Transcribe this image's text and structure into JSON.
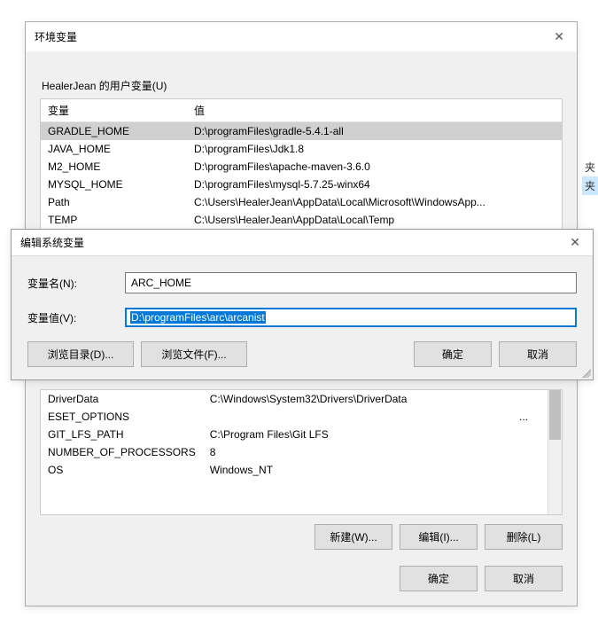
{
  "right_fragment": {
    "l1": "夹",
    "l2": "夹"
  },
  "env_dialog": {
    "title": "环境变量",
    "user_label": "HealerJean 的用户变量(U)",
    "col_var": "变量",
    "col_val": "值",
    "user_rows": [
      {
        "name": "GRADLE_HOME",
        "value": "D:\\programFiles\\gradle-5.4.1-all",
        "selected": true
      },
      {
        "name": "JAVA_HOME",
        "value": "D:\\programFiles\\Jdk1.8"
      },
      {
        "name": "M2_HOME",
        "value": "D:\\programFiles\\apache-maven-3.6.0"
      },
      {
        "name": "MYSQL_HOME",
        "value": "D:\\programFiles\\mysql-5.7.25-winx64"
      },
      {
        "name": "Path",
        "value": "C:\\Users\\HealerJean\\AppData\\Local\\Microsoft\\WindowsApp..."
      },
      {
        "name": "TEMP",
        "value": "C:\\Users\\HealerJean\\AppData\\Local\\Temp"
      }
    ],
    "sys_rows": [
      {
        "name": "DriverData",
        "value": "C:\\Windows\\System32\\Drivers\\DriverData"
      },
      {
        "name": "ESET_OPTIONS",
        "value": "",
        "dots": "..."
      },
      {
        "name": "GIT_LFS_PATH",
        "value": "C:\\Program Files\\Git LFS"
      },
      {
        "name": "NUMBER_OF_PROCESSORS",
        "value": "8"
      },
      {
        "name": "OS",
        "value": "Windows_NT"
      }
    ],
    "btn_new": "新建(W)...",
    "btn_edit": "编辑(I)...",
    "btn_delete": "删除(L)",
    "btn_ok": "确定",
    "btn_cancel": "取消"
  },
  "edit_dialog": {
    "title": "编辑系统变量",
    "name_label": "变量名(N):",
    "name_value": "ARC_HOME",
    "value_label": "变量值(V):",
    "value_value": "D:\\programFiles\\arc\\arcanist",
    "btn_browse_dir": "浏览目录(D)...",
    "btn_browse_file": "浏览文件(F)...",
    "btn_ok": "确定",
    "btn_cancel": "取消"
  }
}
